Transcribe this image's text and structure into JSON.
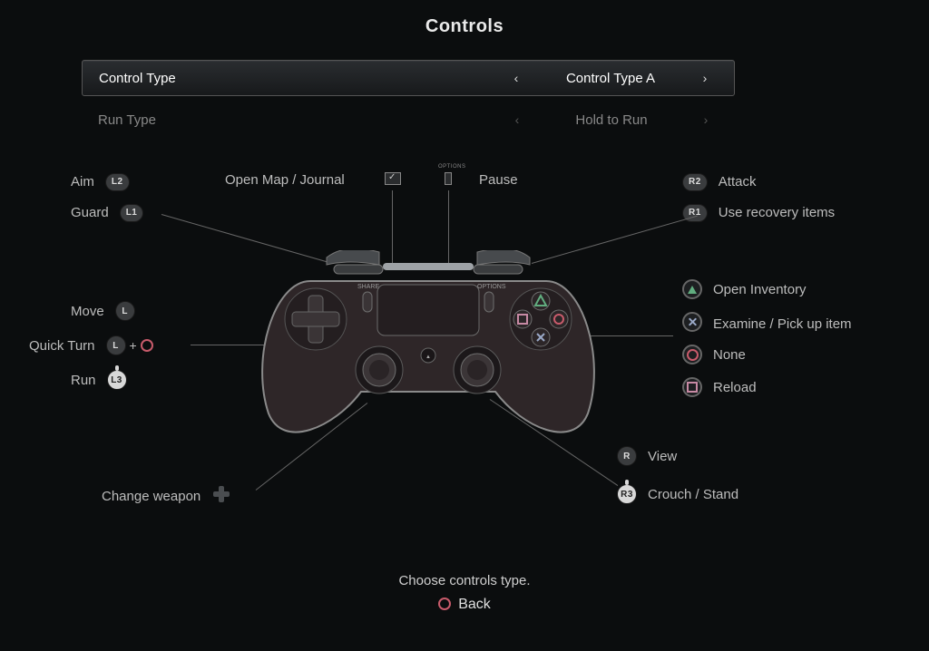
{
  "title": "Controls",
  "selectors": {
    "control_type": {
      "label": "Control Type",
      "value": "Control Type A"
    },
    "run_type": {
      "label": "Run Type",
      "value": "Hold to Run"
    }
  },
  "top": {
    "open_map": "Open Map / Journal",
    "pause": "Pause"
  },
  "left": {
    "aim": {
      "label": "Aim",
      "btn": "L2"
    },
    "guard": {
      "label": "Guard",
      "btn": "L1"
    },
    "move": {
      "label": "Move",
      "btn": "L"
    },
    "quick_turn": {
      "label": "Quick Turn",
      "btn": "L"
    },
    "run": {
      "label": "Run",
      "btn": "L3"
    },
    "change_weapon": "Change weapon"
  },
  "right": {
    "attack": {
      "label": "Attack",
      "btn": "R2"
    },
    "recovery": {
      "label": "Use recovery items",
      "btn": "R1"
    },
    "triangle": "Open Inventory",
    "cross": "Examine / Pick up item",
    "circle": "None",
    "square": "Reload",
    "view": {
      "label": "View",
      "btn": "R"
    },
    "crouch": {
      "label": "Crouch / Stand",
      "btn": "R3"
    }
  },
  "footer": {
    "hint": "Choose controls type.",
    "back": "Back"
  }
}
